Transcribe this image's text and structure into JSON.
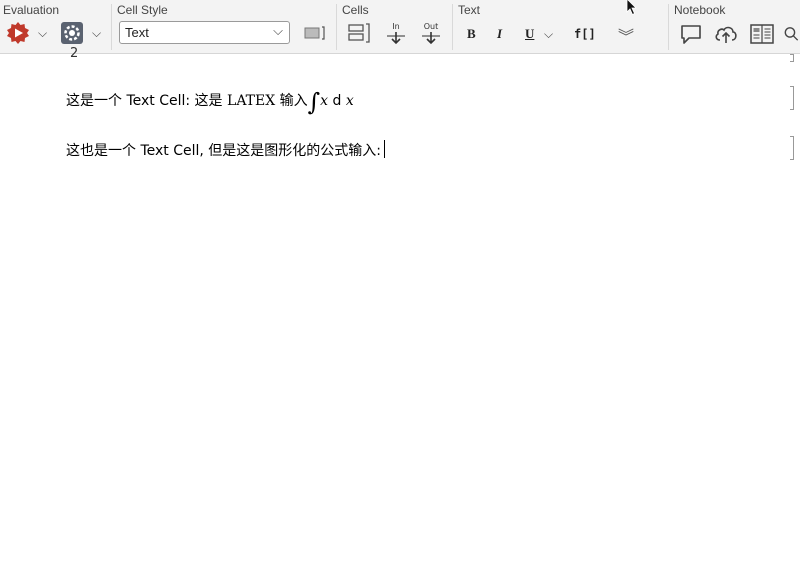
{
  "toolbar": {
    "groups": {
      "evaluation": "Evaluation",
      "cell_style": "Cell Style",
      "cells": "Cells",
      "text": "Text",
      "notebook": "Notebook"
    },
    "cell_style_value": "Text",
    "cells_in_label": "In",
    "cells_out_label": "Out",
    "text_bold": "B",
    "text_italic": "I",
    "text_underline": "U",
    "text_func": "f[]",
    "accent_color": "#c0392b"
  },
  "document": {
    "top_fragment": "2",
    "cell1": {
      "prefix": "这是一个 Text Cell: 这是",
      "latex_label": "LATEX",
      "middle": "输入",
      "integral": "∫",
      "var1": "x",
      "d": "d",
      "var2": "x"
    },
    "cell2": {
      "text": "这也是一个 Text Cell, 但是这是图形化的公式输入:"
    }
  }
}
